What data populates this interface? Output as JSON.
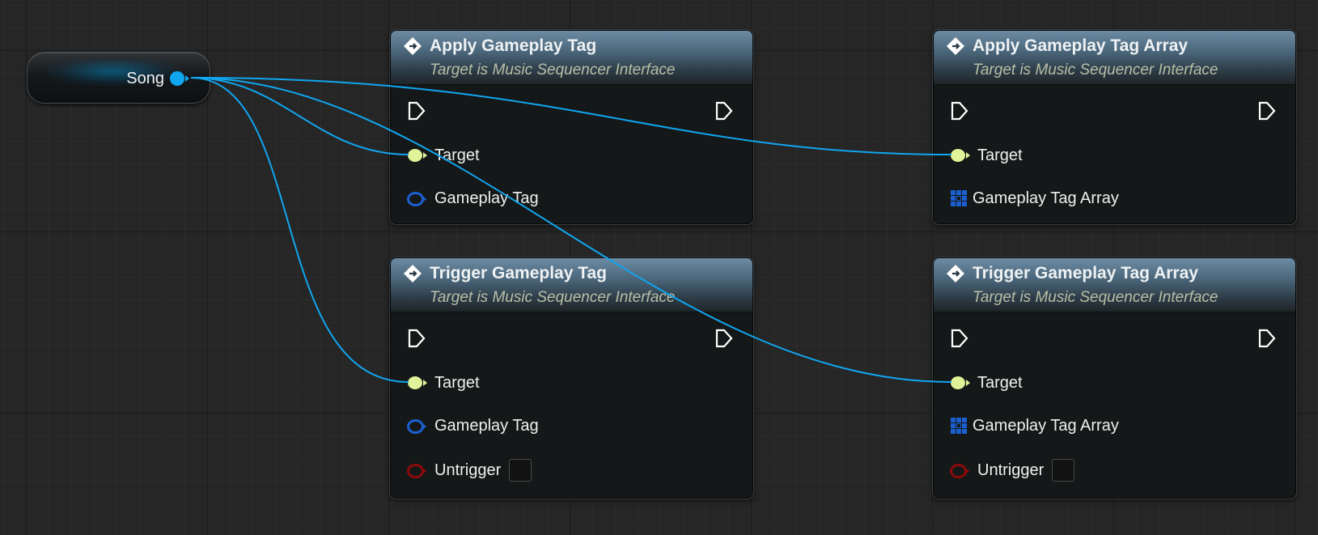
{
  "graph": {
    "variable_node": {
      "label": "Song",
      "pin_color": "#10a6f0"
    },
    "nodes": [
      {
        "id": "apply-tag",
        "title": "Apply Gameplay Tag",
        "subtitle": "Target is Music Sequencer Interface",
        "pins": {
          "target": "Target",
          "param": "Gameplay Tag"
        }
      },
      {
        "id": "apply-tag-array",
        "title": "Apply Gameplay Tag Array",
        "subtitle": "Target is Music Sequencer Interface",
        "pins": {
          "target": "Target",
          "param": "Gameplay Tag Array"
        }
      },
      {
        "id": "trigger-tag",
        "title": "Trigger Gameplay Tag",
        "subtitle": "Target is Music Sequencer Interface",
        "pins": {
          "target": "Target",
          "param": "Gameplay Tag",
          "untrigger": "Untrigger"
        }
      },
      {
        "id": "trigger-tag-array",
        "title": "Trigger Gameplay Tag Array",
        "subtitle": "Target is Music Sequencer Interface",
        "pins": {
          "target": "Target",
          "param": "Gameplay Tag Array",
          "untrigger": "Untrigger"
        }
      }
    ],
    "colors": {
      "wire": "#10a6f0",
      "object_pin": "#e0f398",
      "struct_pin": "#1c5fd0",
      "bool_pin": "#8c0a0a",
      "header": "#4a6579"
    }
  }
}
